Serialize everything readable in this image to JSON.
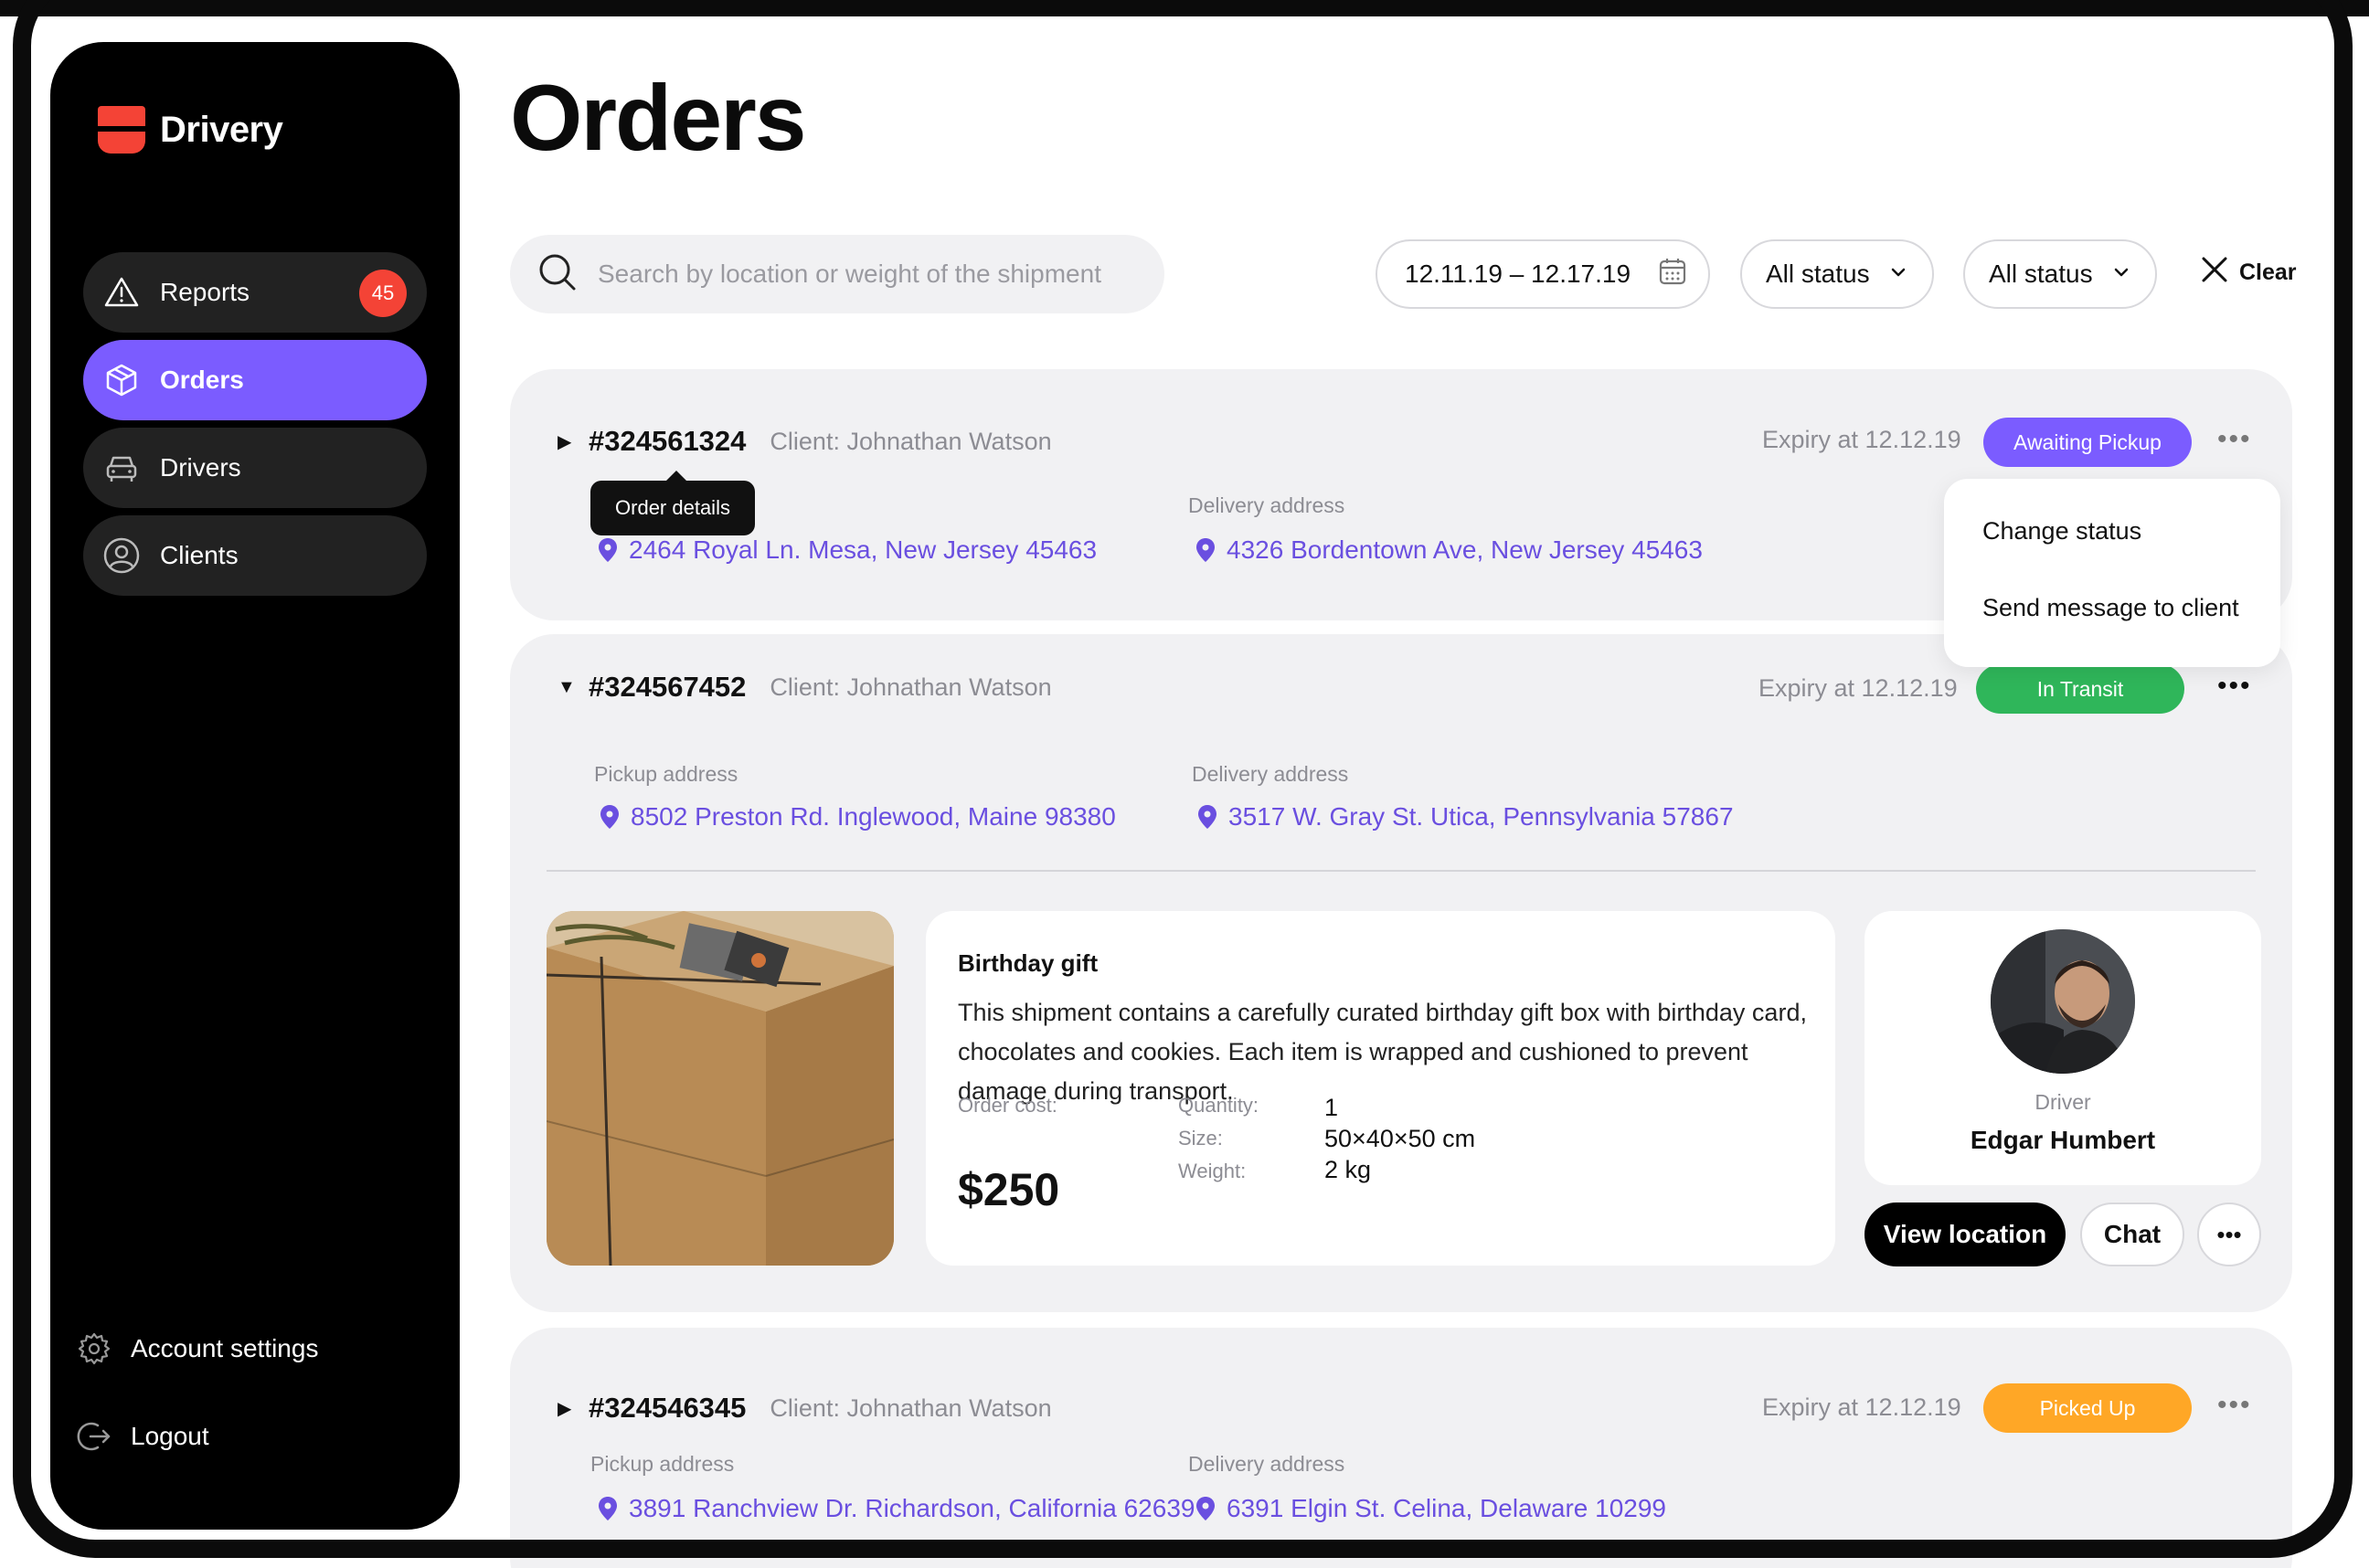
{
  "brand": {
    "name": "Drivery",
    "accent": "#7b5cff",
    "logo_color": "#f44336"
  },
  "sidebar": {
    "items": [
      {
        "label": "Reports",
        "icon": "warning-icon",
        "badge": "45"
      },
      {
        "label": "Orders",
        "icon": "box-icon"
      },
      {
        "label": "Drivers",
        "icon": "car-icon"
      },
      {
        "label": "Clients",
        "icon": "user-circle-icon"
      }
    ],
    "bottom": [
      {
        "label": "Account settings",
        "icon": "gear-icon"
      },
      {
        "label": "Logout",
        "icon": "logout-icon"
      }
    ]
  },
  "page": {
    "title": "Orders"
  },
  "filters": {
    "search_placeholder": "Search by location or weight of the shipment",
    "date_range": "12.11.19 – 12.17.19",
    "status1": "All status",
    "status2": "All status",
    "clear": "Clear"
  },
  "orders": [
    {
      "id": "#324561324",
      "client": "Client: Johnathan Watson",
      "expiry": "Expiry at 12.12.19",
      "status": "Awaiting Pickup",
      "status_color": "#7b5cff",
      "tooltip": "Order details",
      "delivery_label": "Delivery address",
      "pickup_address": "2464 Royal Ln. Mesa, New Jersey 45463",
      "delivery_address": "4326 Bordentown Ave, New Jersey 45463",
      "menu": [
        "Change status",
        "Send message to client"
      ]
    },
    {
      "id": "#324567452",
      "client": "Client: Johnathan Watson",
      "expiry": "Expiry at 12.12.19",
      "status": "In Transit",
      "status_color": "#2fb65a",
      "pickup_label": "Pickup address",
      "delivery_label": "Delivery address",
      "pickup_address": "8502 Preston Rd. Inglewood, Maine 98380",
      "delivery_address": "3517 W. Gray St. Utica, Pennsylvania 57867",
      "details": {
        "title": "Birthday gift",
        "description": "This shipment contains a carefully curated birthday gift box with birthday card, chocolates and cookies. Each item is wrapped and cushioned to prevent damage during transport.",
        "cost_label": "Order cost:",
        "cost": "$250",
        "quantity_label": "Quantity:",
        "quantity": "1",
        "size_label": "Size:",
        "size": "50×40×50 cm",
        "weight_label": "Weight:",
        "weight": "2 kg"
      },
      "driver": {
        "label": "Driver",
        "name": "Edgar Humbert"
      },
      "actions": {
        "view_location": "View location",
        "chat": "Chat"
      }
    },
    {
      "id": "#324546345",
      "client": "Client: Johnathan Watson",
      "expiry": "Expiry at 12.12.19",
      "status": "Picked Up",
      "status_color": "#ffa726",
      "pickup_label": "Pickup address",
      "delivery_label": "Delivery address",
      "pickup_address": "3891 Ranchview Dr. Richardson, California 62639",
      "delivery_address": "6391 Elgin St. Celina, Delaware 10299"
    }
  ]
}
